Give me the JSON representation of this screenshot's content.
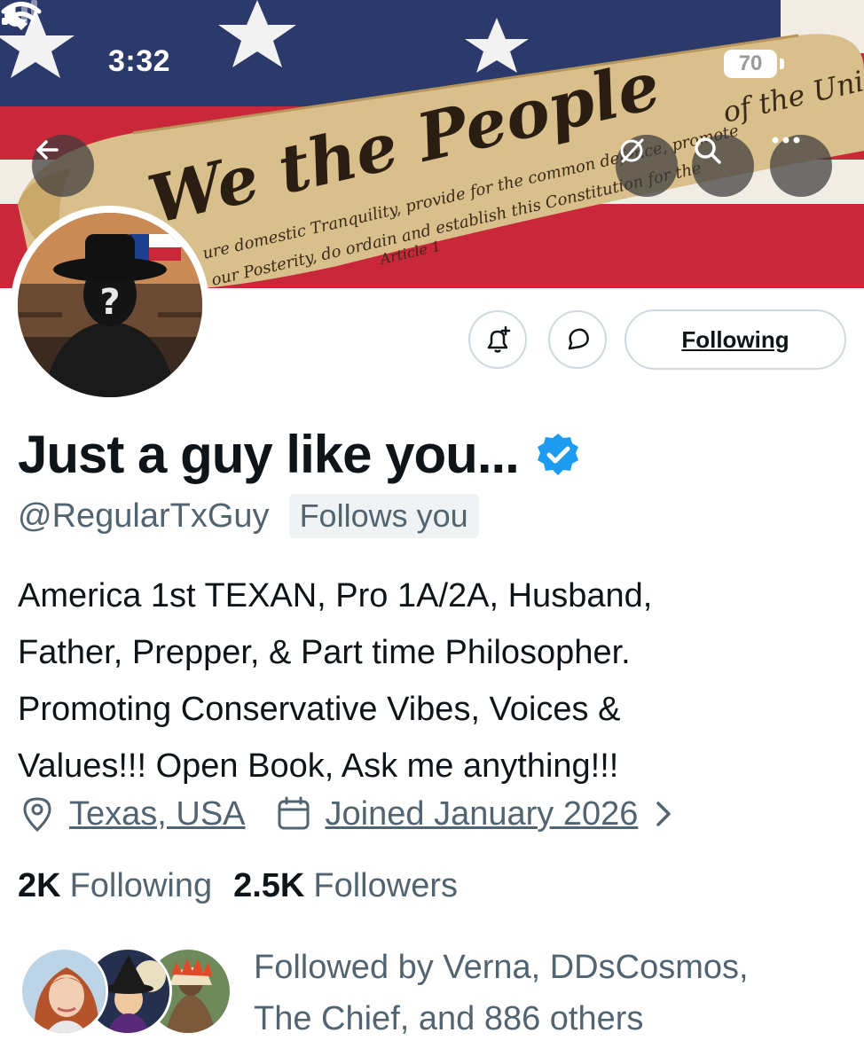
{
  "status_bar": {
    "time": "3:32",
    "battery": "70"
  },
  "banner": {
    "script_text": "We the People",
    "script_text_2": "of the Uni",
    "script_small": "ure domestic Tranquility, provide for the common defence, promote",
    "script_small_2": "our Posterity, do ordain and establish this Constitution for the",
    "script_article": "Article 1"
  },
  "actions": {
    "following_label": "Following"
  },
  "profile": {
    "display_name": "Just a guy like you...",
    "handle": "@RegularTxGuy",
    "follows_you": "Follows you",
    "bio": "America 1st TEXAN, Pro 1A/2A, Husband,\nFather, Prepper, & Part time Philosopher.\nPromoting Conservative Vibes, Voices &\nValues!!! Open Book, Ask me anything!!!",
    "location": "Texas, USA",
    "joined": "Joined January 2026",
    "following_count": "2K",
    "following_label": "Following",
    "followers_count": "2.5K",
    "followers_label": "Followers",
    "followed_by_line1": "Followed by Verna, DDsCosmos,",
    "followed_by_line2": "The Chief, and 886 others"
  },
  "colors": {
    "accent": "#1d9bf0",
    "muted": "#536471",
    "text": "#0f1419",
    "border": "#cfd9de"
  }
}
